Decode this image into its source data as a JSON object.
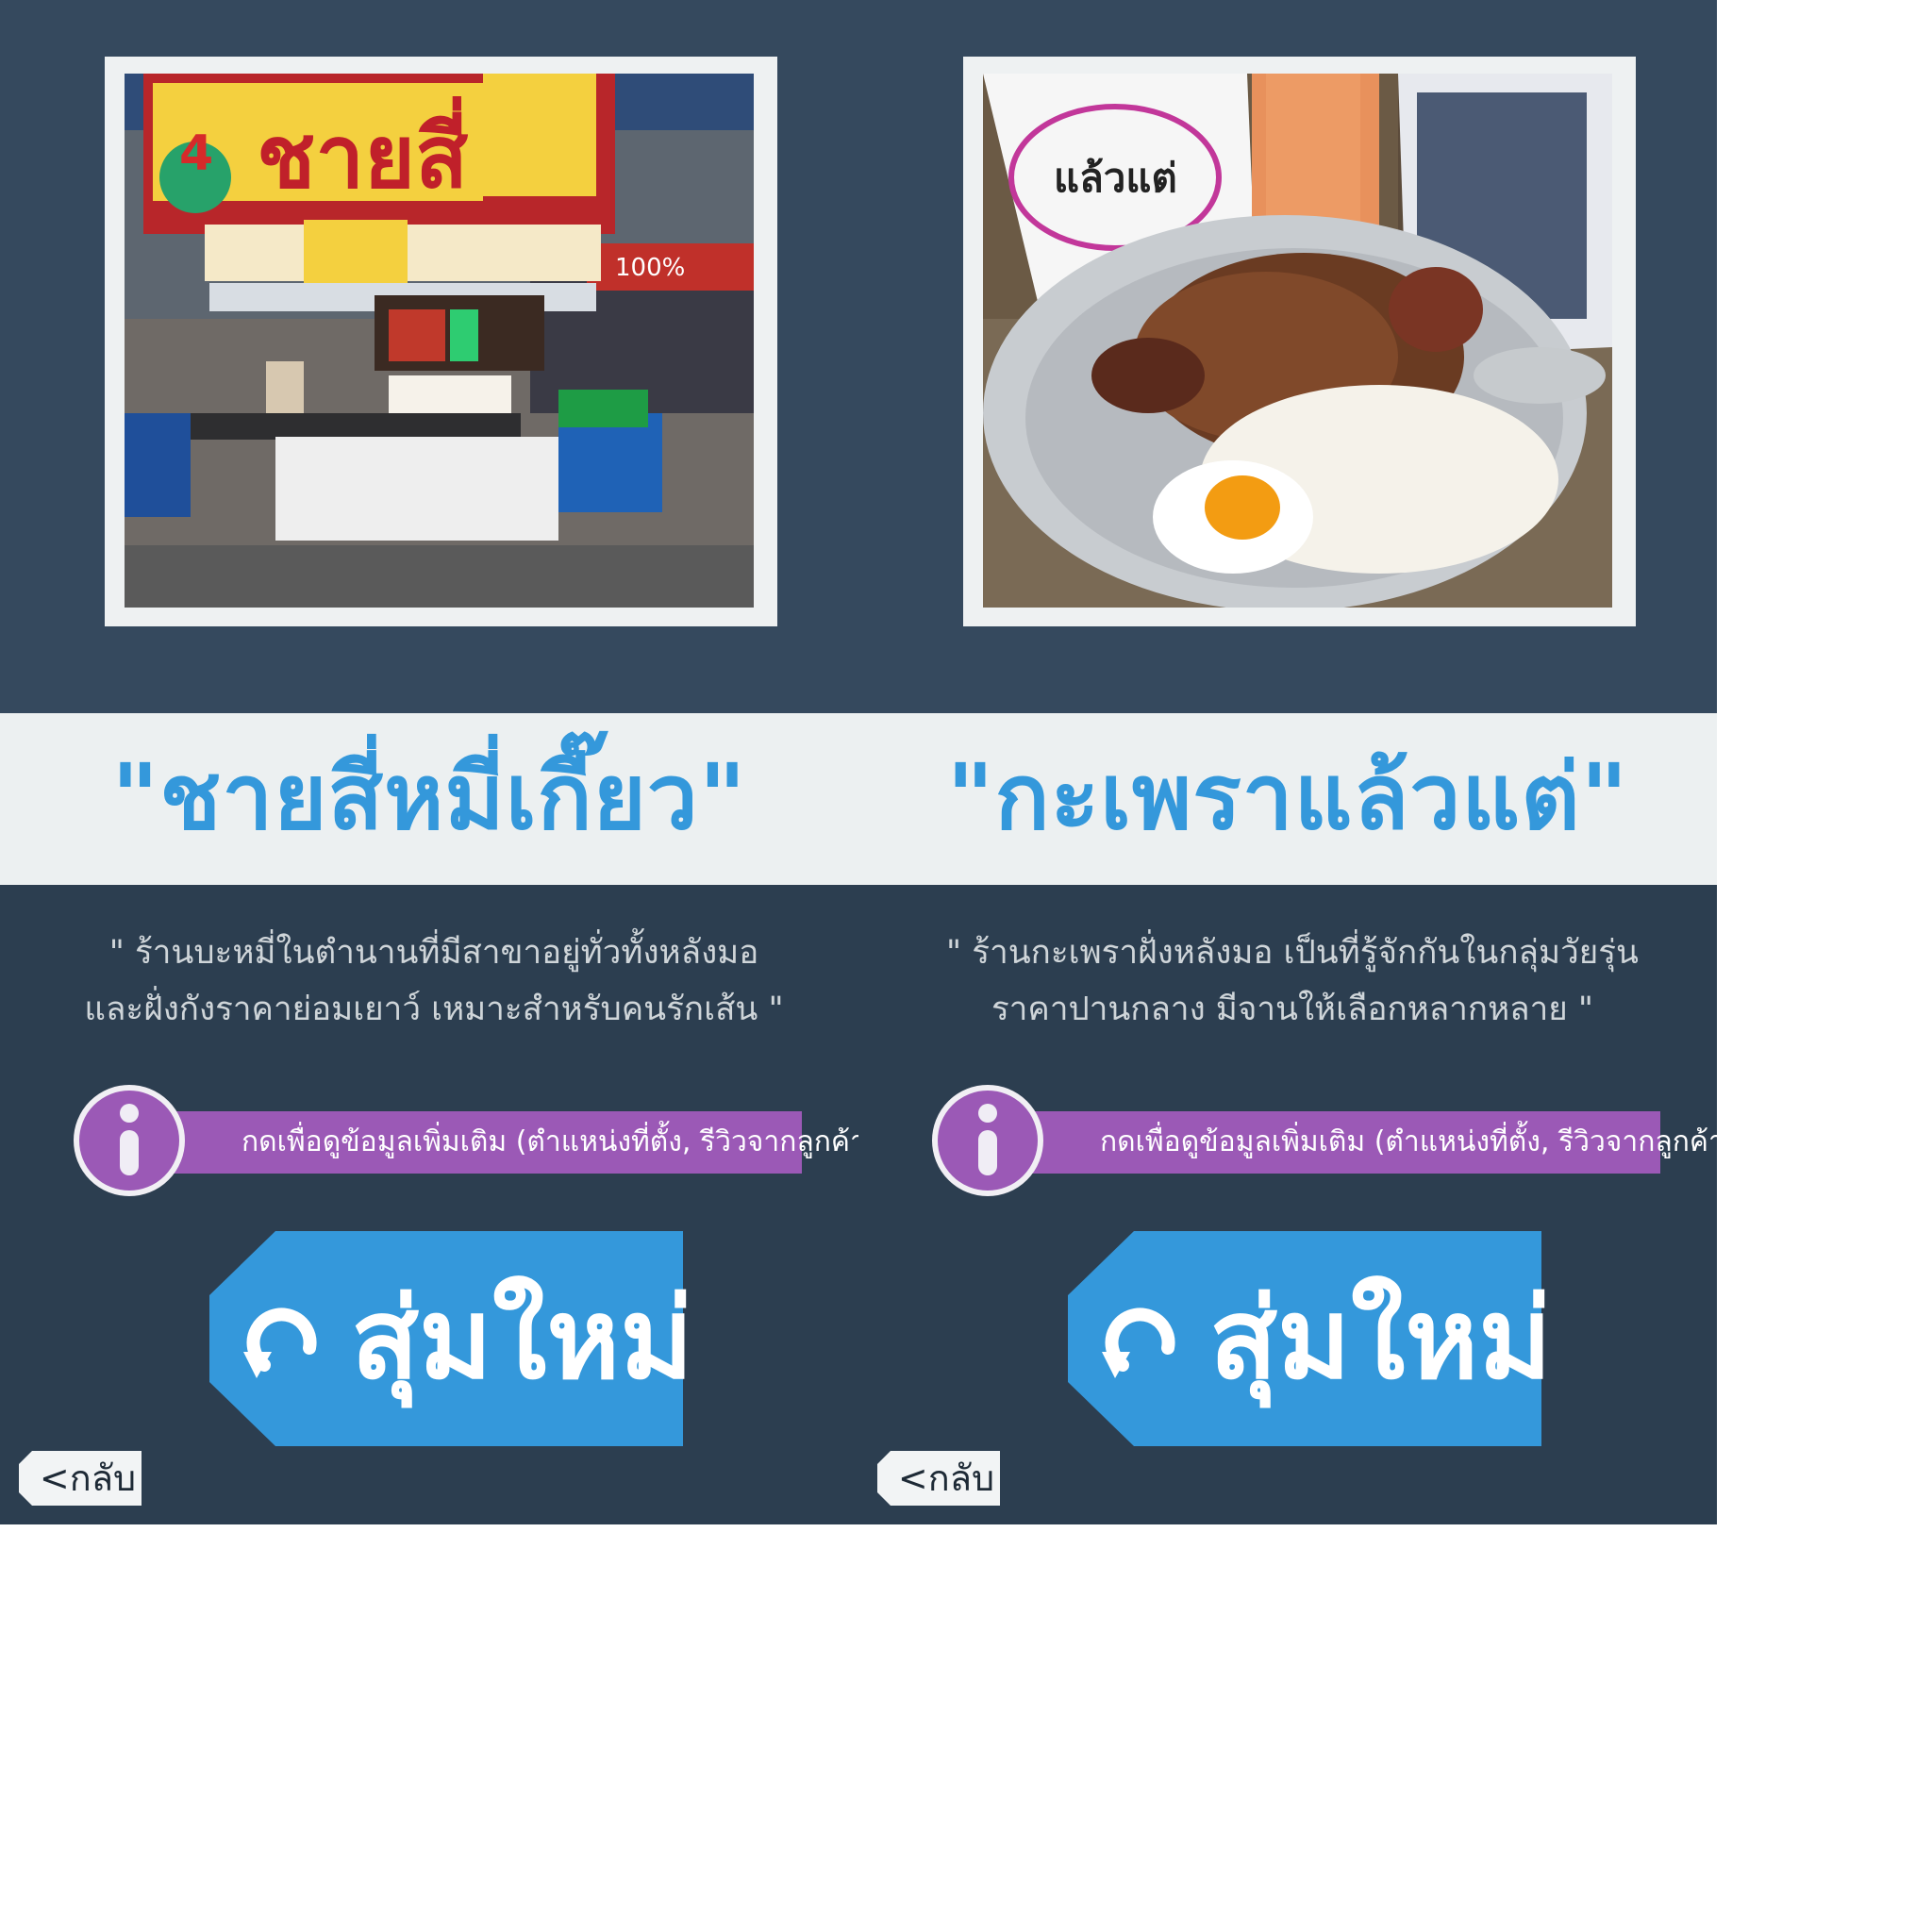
{
  "colors": {
    "top_background": "#35495e",
    "title_band": "#ecf0f1",
    "bottom_background": "#2c3e50",
    "title_text": "#3498db",
    "info_purple": "#9b59b6",
    "random_blue": "#3498db"
  },
  "panels": [
    {
      "title": "\"ชายสี่หมี่เกี๊ยว\"",
      "desc_line1": "\" ร้านบะหมี่ในตำนานที่มีสาขาอยู่ทั่วทั้งหลังมอ",
      "desc_line2": "และฝั่งกังราคาย่อมเยาว์ เหมาะสำหรับคนรักเส้น \"",
      "info_label": "กดเพื่อดูข้อมูลเพิ่มเติม (ตำแหน่งที่ตั้ง, รีวิวจากลูกค้า)",
      "info_icon": "info-icon",
      "random_label": "สุ่มใหม่",
      "random_icon": "refresh-icon",
      "back_label": "<กลับ",
      "photo": {
        "sign_text": "ชายสี่",
        "sign_number": "4",
        "banner_text": "100%"
      }
    },
    {
      "title": "\"กะเพราแล้วแต่\"",
      "desc_line1": "\" ร้านกะเพราฝั่งหลังมอ เป็นที่รู้จักกันในกลุ่มวัยรุ่น",
      "desc_line2": "ราคาปานกลาง มีจานให้เลือกหลากหลาย \"",
      "info_label": "กดเพื่อดูข้อมูลเพิ่มเติม (ตำแหน่งที่ตั้ง, รีวิวจากลูกค้า)",
      "info_icon": "info-icon",
      "random_label": "สุ่มใหม่",
      "random_icon": "refresh-icon",
      "back_label": "<กลับ",
      "photo": {
        "logo_text": "แล้วแต่"
      }
    }
  ]
}
